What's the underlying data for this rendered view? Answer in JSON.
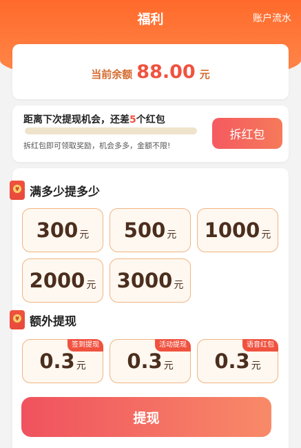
{
  "header": {
    "title": "福利",
    "account_flow": "账户流水"
  },
  "balance": {
    "label": "当前余额",
    "amount": "88.00",
    "unit": "元"
  },
  "redpack": {
    "text_prefix": "距离下次提现机会，还差",
    "count": "5",
    "text_suffix": "个红包",
    "progress": 0,
    "desc": "拆红包即可领取奖励，机会多多，金额不限!",
    "button": "拆红包"
  },
  "section_full": {
    "title": "满多少提多少",
    "options": [
      {
        "value": "300",
        "unit": "元"
      },
      {
        "value": "500",
        "unit": "元"
      },
      {
        "value": "1000",
        "unit": "元"
      },
      {
        "value": "2000",
        "unit": "元"
      },
      {
        "value": "3000",
        "unit": "元"
      }
    ]
  },
  "section_extra": {
    "title": "额外提现",
    "options": [
      {
        "value": "0.3",
        "unit": "元",
        "badge": "签到提现"
      },
      {
        "value": "0.3",
        "unit": "元",
        "badge": "活动提现"
      },
      {
        "value": "0.3",
        "unit": "元",
        "badge": "语音红包"
      }
    ]
  },
  "withdraw_button": "提现",
  "colors": {
    "accent": "#f0523f",
    "header": "#ff6a2b",
    "option_border": "#f0b380"
  }
}
